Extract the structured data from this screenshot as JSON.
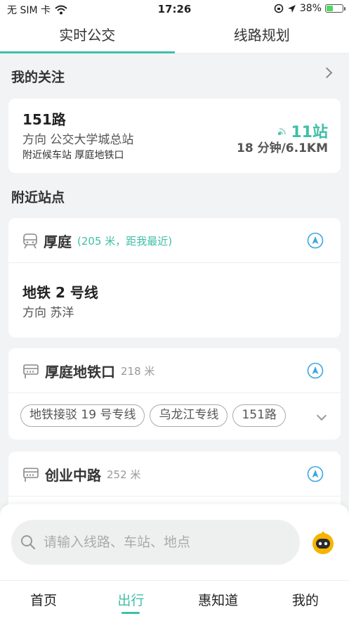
{
  "status_bar": {
    "carrier": "无 SIM 卡",
    "time": "17:26",
    "battery": "38%",
    "battery_level": 0.38
  },
  "tabs": [
    {
      "label": "实时公交",
      "active": true
    },
    {
      "label": "线路规划",
      "active": false
    }
  ],
  "favorites": {
    "title": "我的关注",
    "item": {
      "route": "151路",
      "direction": "方向  公交大学城总站",
      "nearby": "附近候车站 厚庭地铁口",
      "stops": "11站",
      "eta": "18 分钟/6.1KM"
    }
  },
  "nearby": {
    "title": "附近站点",
    "stations": [
      {
        "name": "厚庭",
        "distance": "(205 米，距我最近)",
        "line_name": "地铁 2 号线",
        "line_dir": "方向  苏洋"
      },
      {
        "name": "厚庭地铁口",
        "distance": "218 米",
        "routes": [
          "地铁接驳 19 号专线",
          "乌龙江专线",
          "151路"
        ]
      },
      {
        "name": "创业中路",
        "distance": "252 米"
      }
    ]
  },
  "search": {
    "placeholder": "请输入线路、车站、地点"
  },
  "bottom_nav": [
    {
      "label": "首页"
    },
    {
      "label": "出行",
      "active": true
    },
    {
      "label": "惠知道"
    },
    {
      "label": "我的"
    }
  ],
  "colors": {
    "accent": "#40bfa7",
    "nav_icon": "#3ba7e0"
  }
}
